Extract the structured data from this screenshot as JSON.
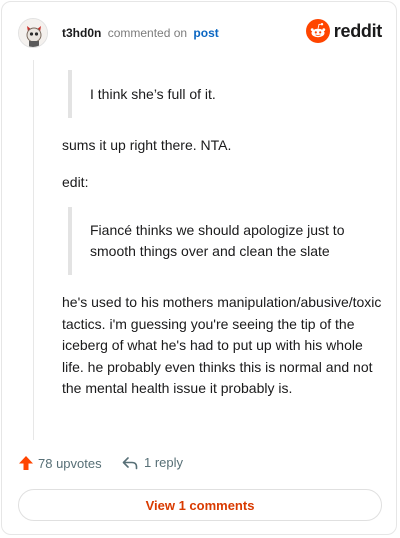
{
  "comment": {
    "username": "t3hd0n",
    "action_text": "commented on",
    "post_link": "post",
    "quote_1": "I think she’s full of it.",
    "paragraph_1": "sums it up right there. NTA.",
    "paragraph_2": "edit:",
    "quote_2": "Fiancé thinks we should apologize just to smooth things over and clean the slate",
    "paragraph_3": "he's used to his mothers manipulation/abusive/toxic tactics. i'm guessing you're seeing the tip of the iceberg of what he's had to put up with his whole life. he probably even thinks this is normal and not the mental health issue it probably is."
  },
  "brand": {
    "name": "reddit",
    "icon": "reddit-logo-icon",
    "color": "#ff4500"
  },
  "actions": {
    "upvotes": "78 upvotes",
    "replies": "1 reply",
    "view_comments": "View 1 comments"
  },
  "colors": {
    "accent": "#d93a00",
    "upvote": "#ff4500",
    "link": "#0a66c2"
  }
}
